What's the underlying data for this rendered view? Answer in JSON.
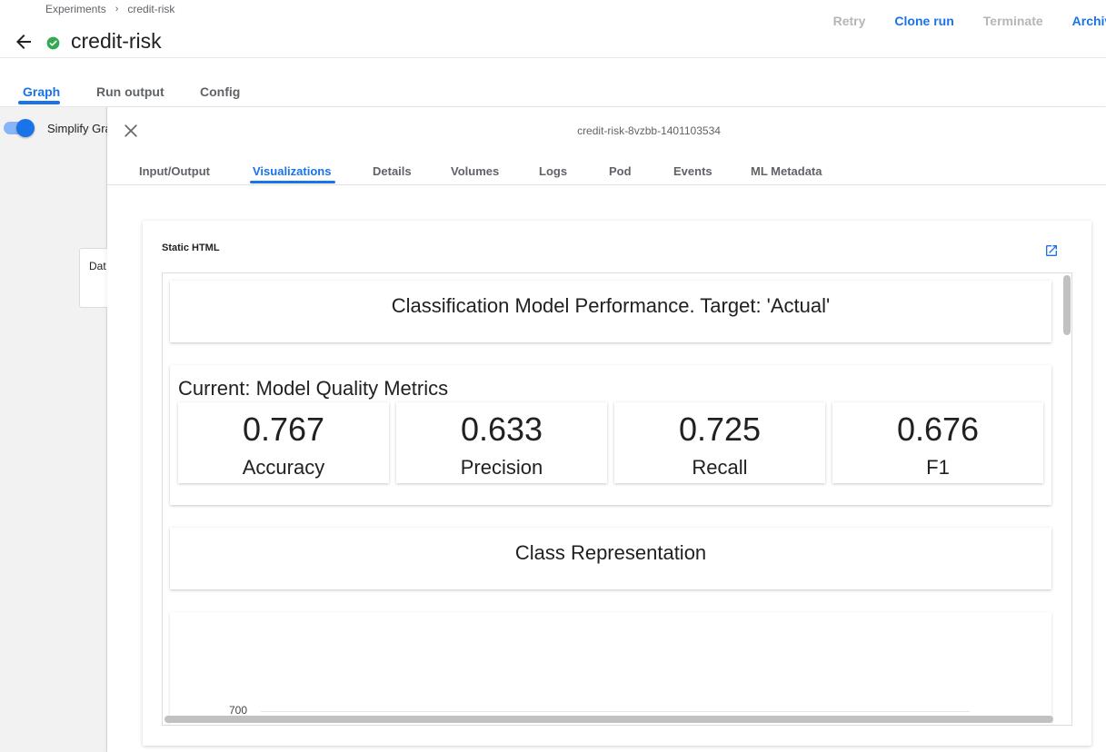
{
  "breadcrumb": {
    "items": [
      "Experiments",
      "credit-risk"
    ],
    "separator": "›"
  },
  "header": {
    "title": "credit-risk",
    "status_icon": "check-circle-icon",
    "status_color": "#34a853"
  },
  "actions": {
    "retry": "Retry",
    "clone_run": "Clone run",
    "terminate": "Terminate",
    "archive": "Archive"
  },
  "main_tabs": [
    {
      "label": "Graph",
      "active": true
    },
    {
      "label": "Run output",
      "active": false
    },
    {
      "label": "Config",
      "active": false
    }
  ],
  "graph": {
    "simplify_label": "Simplify Graph",
    "simplify_on": true,
    "node_label": "Dat"
  },
  "panel": {
    "title": "credit-risk-8vzbb-1401103534",
    "tabs": [
      {
        "label": "Input/Output",
        "active": false
      },
      {
        "label": "Visualizations",
        "active": true
      },
      {
        "label": "Details",
        "active": false
      },
      {
        "label": "Volumes",
        "active": false
      },
      {
        "label": "Logs",
        "active": false
      },
      {
        "label": "Pod",
        "active": false
      },
      {
        "label": "Events",
        "active": false
      },
      {
        "label": "ML Metadata",
        "active": false
      }
    ]
  },
  "visualization": {
    "type_label": "Static HTML",
    "report_title": "Classification Model Performance. Target: 'Actual'",
    "metrics_heading": "Current: Model Quality Metrics",
    "metrics": [
      {
        "value": "0.767",
        "label": "Accuracy"
      },
      {
        "value": "0.633",
        "label": "Precision"
      },
      {
        "value": "0.725",
        "label": "Recall"
      },
      {
        "value": "0.676",
        "label": "F1"
      }
    ],
    "class_representation_title": "Class Representation",
    "chart_tick_top": "700"
  },
  "colors": {
    "accent": "#1a73e8",
    "disabled": "#b4b6b9",
    "success": "#34a853"
  }
}
